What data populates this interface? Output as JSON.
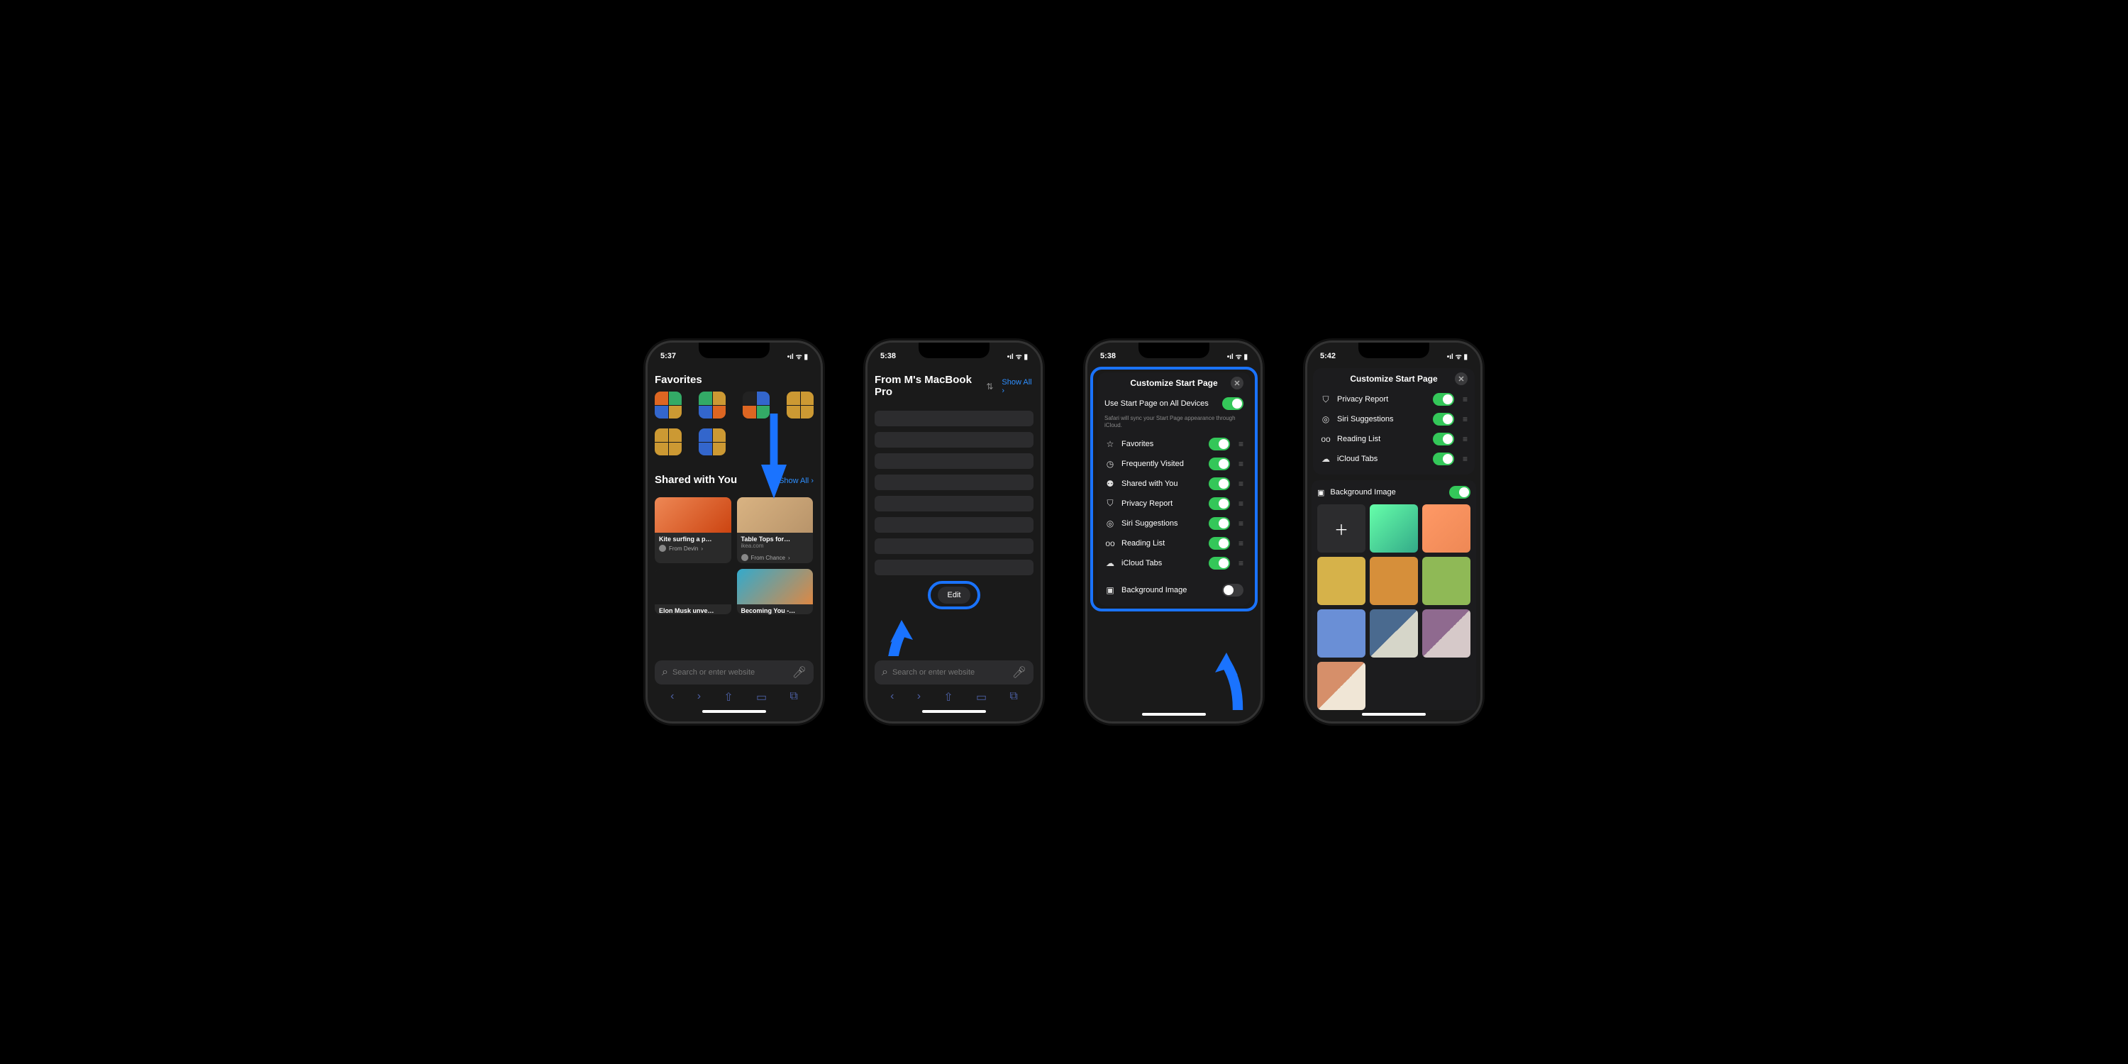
{
  "phones": {
    "p1": {
      "time": "5:37"
    },
    "p2": {
      "time": "5:38"
    },
    "p3": {
      "time": "5:38"
    },
    "p4": {
      "time": "5:42"
    }
  },
  "status_icons": "•ıl ᯤ ▮",
  "favorites": {
    "title": "Favorites"
  },
  "shared": {
    "title": "Shared with You",
    "show_all": "Show All",
    "cards": {
      "c1": {
        "title": "Kite surfing a p…",
        "from": "From Devin"
      },
      "c2": {
        "title": "Table Tops for…",
        "sub": "ikea.com",
        "from": "From Chance"
      },
      "c3": {
        "title": "Elon Musk unve…"
      },
      "c4": {
        "title": "Becoming You -…"
      }
    }
  },
  "search": {
    "placeholder": "Search or enter website"
  },
  "from_mac": {
    "title": "From M's MacBook Pro",
    "show_all": "Show All"
  },
  "edit_label": "Edit",
  "customize": {
    "title": "Customize Start Page",
    "use_all": "Use Start Page on All Devices",
    "hint": "Safari will sync your Start Page appearance through iCloud.",
    "rows": {
      "favorites": "Favorites",
      "frequent": "Frequently Visited",
      "shared": "Shared with You",
      "privacy": "Privacy Report",
      "siri": "Siri Suggestions",
      "reading": "Reading List",
      "icloud": "iCloud Tabs"
    },
    "bg": "Background Image"
  },
  "bg_tile_colors": [
    "#7fa3c9",
    "#d6a24a",
    "#8fb956",
    "#6a8fd6",
    "#4a6a8f",
    "#8f6a8f",
    "#d68f6a"
  ]
}
